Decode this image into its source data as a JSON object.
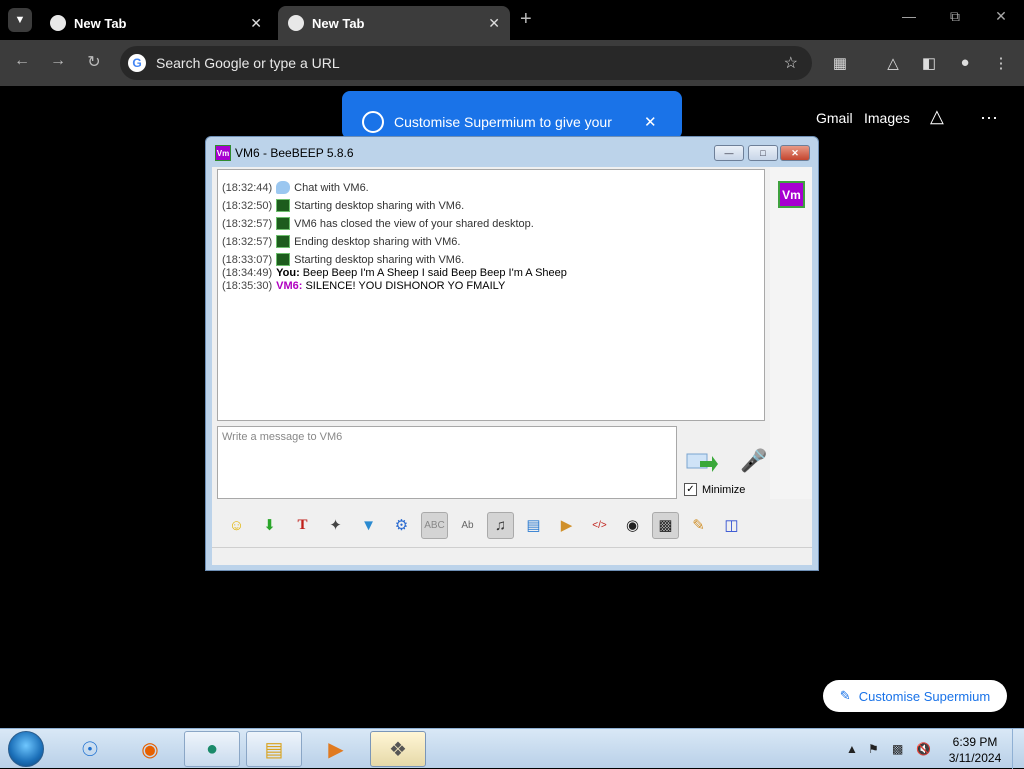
{
  "browser": {
    "tabs": [
      {
        "label": "New Tab",
        "active": false
      },
      {
        "label": "New Tab",
        "active": true
      }
    ],
    "new_tab_symbol": "+",
    "omnibox_placeholder": "Search Google or type a URL",
    "promo_text": "Customise Supermium to give your",
    "ntp_links": [
      "Gmail",
      "Images"
    ],
    "customise_button": "Customise Supermium",
    "accent_color": "#1a73e8"
  },
  "beebeep": {
    "title": "VM6 - BeeBEEP 5.8.6",
    "avatar_label": "Vm",
    "messages": [
      {
        "time": "(18:32:44)",
        "icon": "chat-bubble-icon",
        "text": "Chat with VM6."
      },
      {
        "time": "(18:32:50)",
        "icon": "desktop-share-icon",
        "text": "Starting desktop sharing with VM6."
      },
      {
        "time": "(18:32:57)",
        "icon": "desktop-share-icon",
        "text": "VM6 has closed the view of your shared desktop."
      },
      {
        "time": "(18:32:57)",
        "icon": "desktop-share-icon",
        "text": "Ending desktop sharing with VM6."
      },
      {
        "time": "(18:33:07)",
        "icon": "desktop-share-icon",
        "text": "Starting desktop sharing with VM6."
      },
      {
        "time": "(18:34:49)",
        "sender": "You:",
        "text": "Beep Beep I'm A Sheep I said Beep Beep I'm A Sheep"
      },
      {
        "time": "(18:35:30)",
        "sender": "VM6:",
        "text": "SILENCE! YOU DISHONOR YO FMAILY"
      }
    ],
    "input_placeholder": "Write a message to VM6",
    "minimize_label": "Minimize",
    "minimize_checked": true,
    "vm6_color": "#b000c0"
  },
  "taskbar": {
    "clock_time": "6:39 PM",
    "clock_date": "3/11/2024"
  }
}
